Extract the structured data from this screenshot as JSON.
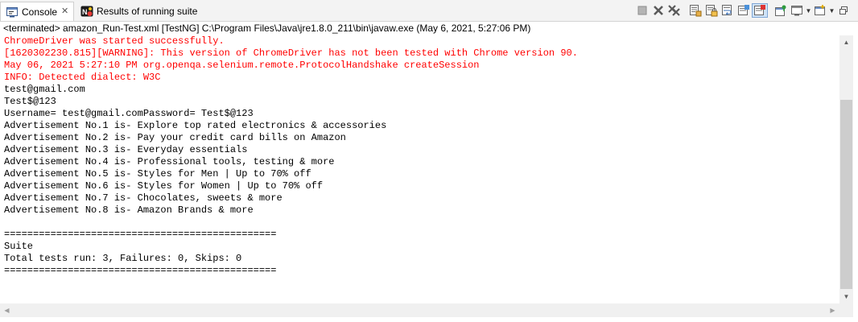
{
  "tabs": {
    "console_label": "Console",
    "console_close": "✕",
    "results_label": "Results of running suite"
  },
  "toolbar": {
    "icons": [
      "terminate-icon",
      "remove-launch-icon",
      "remove-all-terminated-icon",
      "clear-console-icon",
      "scroll-lock-icon",
      "word-wrap-icon",
      "show-on-stdout-icon",
      "show-on-stderr-icon",
      "pin-console-icon",
      "display-selected-console-icon",
      "open-console-icon",
      "minimize-icon"
    ]
  },
  "status_line": "<terminated> amazon_Run-Test.xml [TestNG] C:\\Program Files\\Java\\jre1.8.0_211\\bin\\javaw.exe (May 6, 2021, 5:27:06 PM)",
  "console": {
    "lines": [
      {
        "text": "ChromeDriver was started successfully.",
        "stream": "err"
      },
      {
        "text": "[1620302230.815][WARNING]: This version of ChromeDriver has not been tested with Chrome version 90.",
        "stream": "err"
      },
      {
        "text": "May 06, 2021 5:27:10 PM org.openqa.selenium.remote.ProtocolHandshake createSession",
        "stream": "err"
      },
      {
        "text": "INFO: Detected dialect: W3C",
        "stream": "err"
      },
      {
        "text": "test@gmail.com",
        "stream": "out"
      },
      {
        "text": "Test$@123",
        "stream": "out"
      },
      {
        "text": "Username= test@gmail.comPassword= Test$@123",
        "stream": "out"
      },
      {
        "text": "Advertisement No.1 is- Explore top rated electronics & accessories",
        "stream": "out"
      },
      {
        "text": "Advertisement No.2 is- Pay your credit card bills on Amazon",
        "stream": "out"
      },
      {
        "text": "Advertisement No.3 is- Everyday essentials",
        "stream": "out"
      },
      {
        "text": "Advertisement No.4 is- Professional tools, testing & more",
        "stream": "out"
      },
      {
        "text": "Advertisement No.5 is- Styles for Men | Up to 70% off",
        "stream": "out"
      },
      {
        "text": "Advertisement No.6 is- Styles for Women | Up to 70% off",
        "stream": "out"
      },
      {
        "text": "Advertisement No.7 is- Chocolates, sweets & more",
        "stream": "out"
      },
      {
        "text": "Advertisement No.8 is- Amazon Brands & more",
        "stream": "out"
      },
      {
        "text": "",
        "stream": "out"
      },
      {
        "text": "===============================================",
        "stream": "out"
      },
      {
        "text": "Suite",
        "stream": "out"
      },
      {
        "text": "Total tests run: 3, Failures: 0, Skips: 0",
        "stream": "out"
      },
      {
        "text": "===============================================",
        "stream": "out"
      }
    ],
    "stream_colors": {
      "err": "#ff0000",
      "out": "#000000"
    }
  },
  "scrollbars": {
    "up_arrow": "▲",
    "down_arrow": "▼",
    "left_arrow": "◀",
    "right_arrow": "▶"
  }
}
